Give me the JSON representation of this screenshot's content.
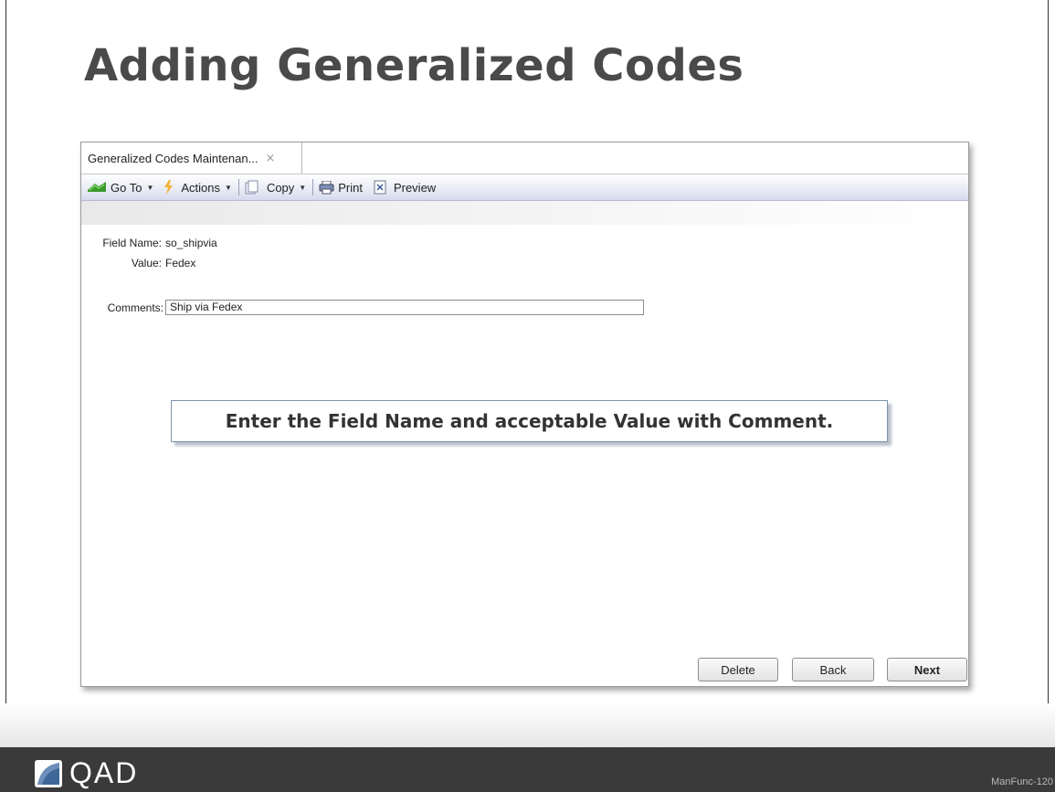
{
  "slide": {
    "title": "Adding Generalized Codes",
    "callout": "Enter the Field Name and acceptable  Value with Comment.",
    "footer": {
      "logo_text": "QAD",
      "slide_number": "ManFunc-120"
    }
  },
  "window": {
    "tab": {
      "label": "Generalized Codes Maintenan...",
      "close_glyph": "×"
    },
    "toolbar": {
      "goto_label": "Go To",
      "actions_label": "Actions",
      "copy_label": "Copy",
      "print_label": "Print",
      "preview_label": "Preview"
    },
    "form": {
      "field_name_label": "Field Name:",
      "field_name_value": "so_shipvia",
      "value_label": "Value:",
      "value_value": "Fedex",
      "comments_label": "Comments:",
      "comments_value": "Ship via Fedex"
    },
    "buttons": {
      "delete": "Delete",
      "back": "Back",
      "next": "Next"
    }
  },
  "colors": {
    "title": "#4a4a4a",
    "footer_bg": "#3a3a3a",
    "toolbar_accent": "#d4d9ee",
    "callout_border": "#7d93ad"
  },
  "icons": {
    "goto": "green-arrow-icon",
    "actions": "lightning-icon",
    "copy": "copy-icon",
    "print": "printer-icon",
    "preview": "preview-icon",
    "logo": "qad-logo-icon"
  }
}
